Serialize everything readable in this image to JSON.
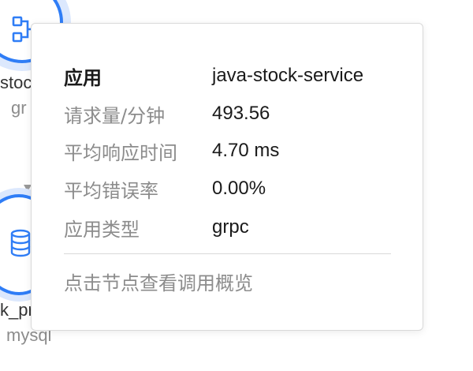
{
  "graph": {
    "nodes": [
      {
        "name": "stoc",
        "type": "gr",
        "icon": "service-topology-icon"
      },
      {
        "name": "k_pr",
        "type": "mysql",
        "icon": "database-icon"
      }
    ],
    "colors": {
      "node_border": "#2f7df6",
      "node_halo": "#dce8fd",
      "edge": "#9a9a9a"
    }
  },
  "tooltip": {
    "rows": [
      {
        "key": "应用",
        "value": "java-stock-service"
      },
      {
        "key": "请求量/分钟",
        "value": "493.56"
      },
      {
        "key": "平均响应时间",
        "value": "4.70 ms"
      },
      {
        "key": "平均错误率",
        "value": "0.00%"
      },
      {
        "key": "应用类型",
        "value": "grpc"
      }
    ],
    "hint": "点击节点查看调用概览"
  }
}
